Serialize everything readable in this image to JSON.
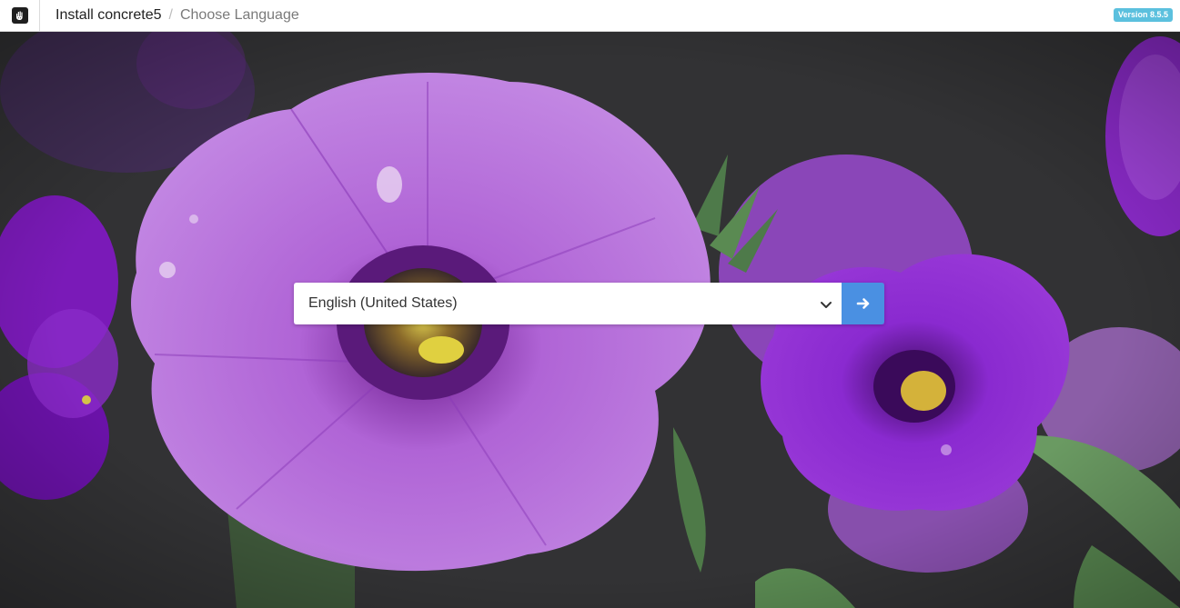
{
  "header": {
    "logo_icon": "concrete5-hand-logo-icon",
    "breadcrumb": {
      "root_label": "Install concrete5",
      "separator": "/",
      "current_label": "Choose Language"
    },
    "version_badge": "Version 8.5.5"
  },
  "language_form": {
    "selected_language": "English (United States)",
    "dropdown_icon": "chevron-down-icon",
    "submit_icon": "arrow-right-icon"
  },
  "colors": {
    "badge": "#5bc0de",
    "submit_button": "#4a90e2",
    "petal": "#b25fd6",
    "petal_dark": "#7b1fb3",
    "background": "#2f2f31"
  }
}
